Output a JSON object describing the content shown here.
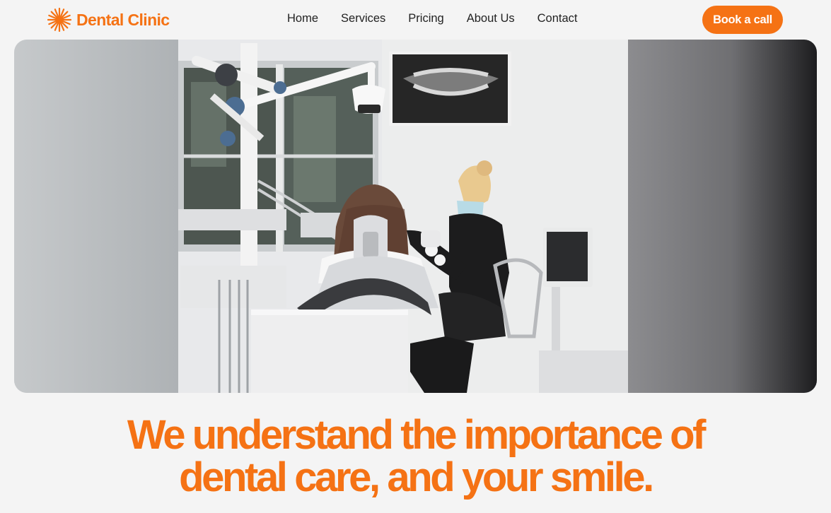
{
  "brand": {
    "name": "Dental Clinic",
    "icon": "asterisk-burst-icon",
    "color": "#f57214"
  },
  "nav": {
    "items": [
      {
        "label": "Home"
      },
      {
        "label": "Services"
      },
      {
        "label": "Pricing"
      },
      {
        "label": "About Us"
      },
      {
        "label": "Contact"
      }
    ],
    "cta_label": "Book a call"
  },
  "hero": {
    "image_alt": "Dentist treating a patient in a modern clinic"
  },
  "headline": {
    "line1": "We understand the importance of",
    "line2": "dental care, and your smile."
  }
}
